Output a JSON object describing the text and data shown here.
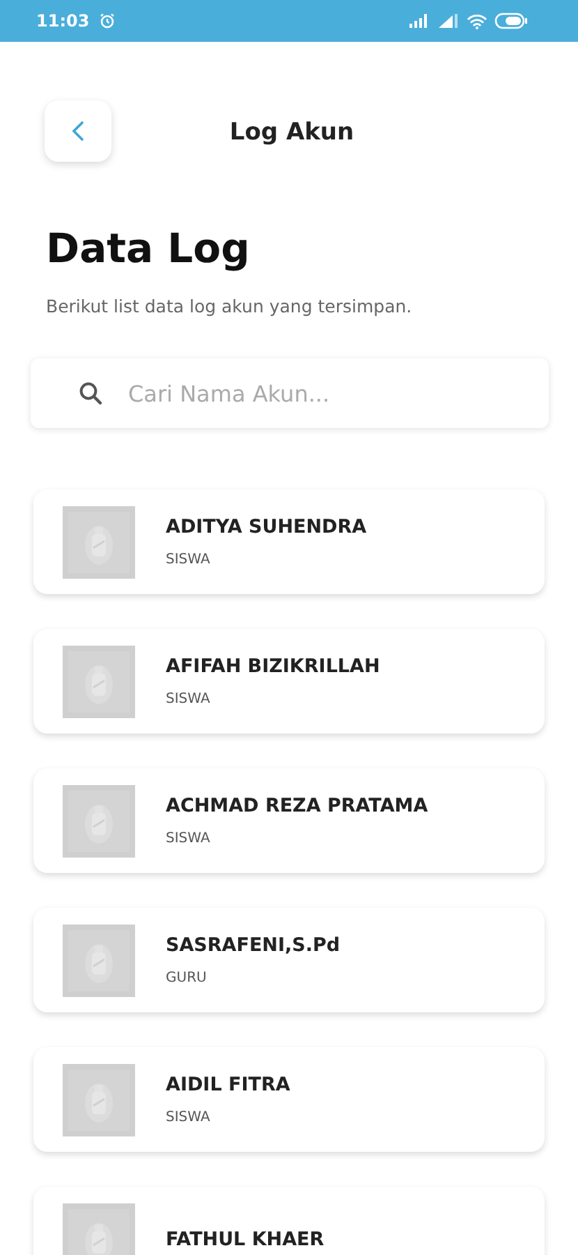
{
  "status_bar": {
    "time": "11:03"
  },
  "header": {
    "title": "Log Akun"
  },
  "heading": "Data Log",
  "description": "Berikut list data log akun yang tersimpan.",
  "search": {
    "placeholder": "Cari Nama Akun..."
  },
  "accounts": [
    {
      "name": "ADITYA SUHENDRA",
      "role": "SISWA"
    },
    {
      "name": "AFIFAH BIZIKRILLAH",
      "role": "SISWA"
    },
    {
      "name": "ACHMAD REZA PRATAMA",
      "role": "SISWA"
    },
    {
      "name": "SASRAFENI,S.Pd",
      "role": "GURU"
    },
    {
      "name": "AIDIL FITRA",
      "role": "SISWA"
    },
    {
      "name": "FATHUL KHAER"
    }
  ]
}
